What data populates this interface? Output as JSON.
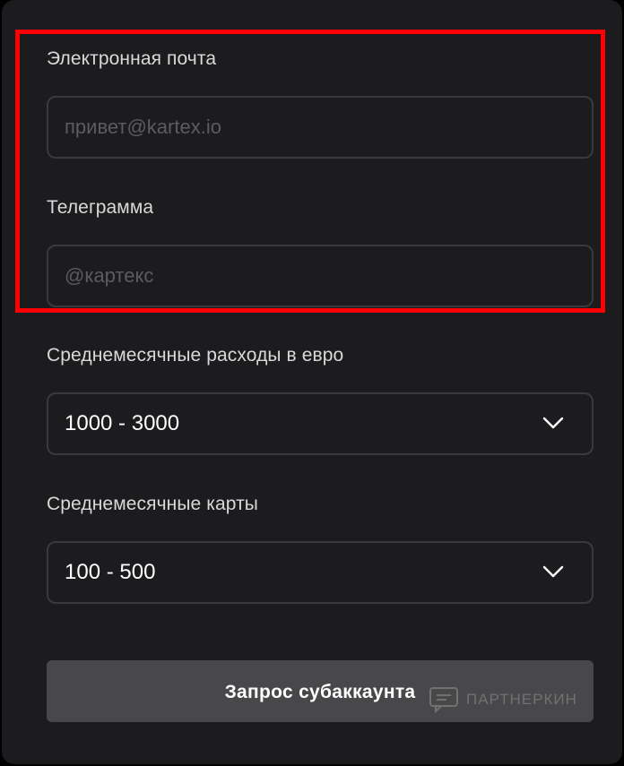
{
  "form": {
    "email": {
      "label": "Электронная почта",
      "placeholder": "привет@kartex.io",
      "value": ""
    },
    "telegram": {
      "label": "Телеграмма",
      "placeholder": "@картекс",
      "value": ""
    },
    "monthly_spend": {
      "label": "Среднемесячные расходы в евро",
      "selected": "1000 - 3000"
    },
    "monthly_cards": {
      "label": "Среднемесячные карты",
      "selected": "100 - 500"
    },
    "submit_label": "Запрос субаккаунта"
  },
  "watermark": {
    "text": "ПАРТНЕРКИН",
    "icon": "partnerkin-logo-icon"
  },
  "colors": {
    "panel_bg": "#1c1c1e",
    "field_border": "#3a3a3c",
    "highlight_border": "#ff0000",
    "button_bg": "#48484a"
  }
}
